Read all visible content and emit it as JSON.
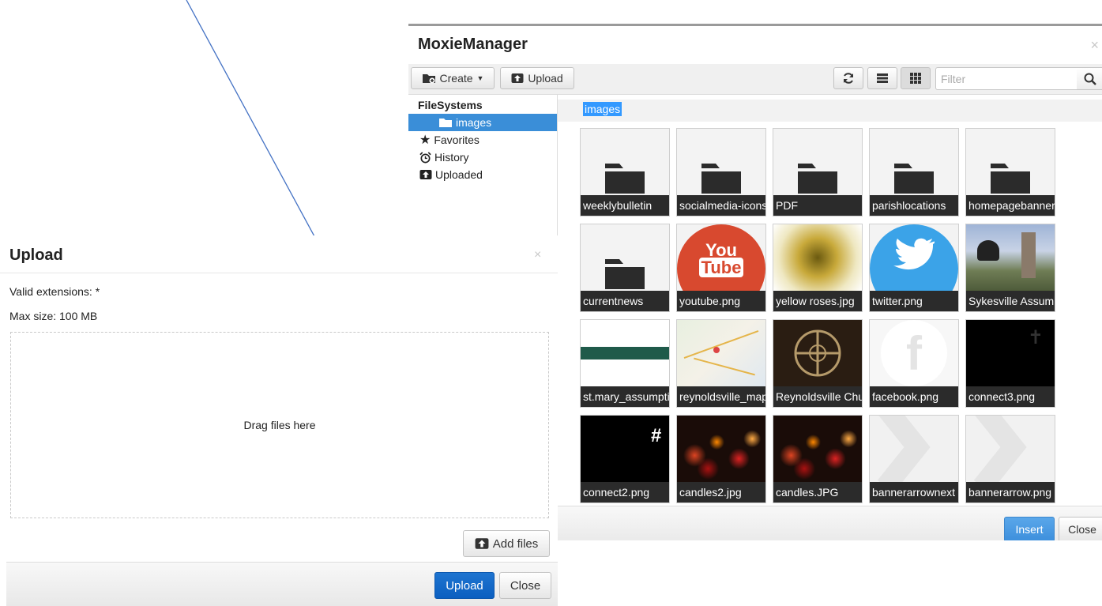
{
  "moxie": {
    "title": "MoxieManager",
    "close_glyph": "×",
    "toolbar": {
      "create_label": "Create",
      "upload_label": "Upload",
      "filter_placeholder": "Filter"
    },
    "sidebar": {
      "heading": "FileSystems",
      "items": [
        {
          "label": "images",
          "icon": "folder-icon",
          "active": true
        },
        {
          "label": "Favorites",
          "icon": "star-icon"
        },
        {
          "label": "History",
          "icon": "alarm-clock-icon"
        },
        {
          "label": "Uploaded",
          "icon": "upload-icon"
        }
      ]
    },
    "breadcrumb": "images",
    "files": [
      {
        "name": "weeklybulletin",
        "kind": "folder"
      },
      {
        "name": "socialmedia-icons",
        "kind": "folder"
      },
      {
        "name": "PDF",
        "kind": "folder"
      },
      {
        "name": "parishlocations",
        "kind": "folder"
      },
      {
        "name": "homepagebanners",
        "kind": "folder"
      },
      {
        "name": "currentnews",
        "kind": "folder"
      },
      {
        "name": "youtube.png",
        "kind": "youtube"
      },
      {
        "name": "yellow roses.jpg",
        "kind": "roses"
      },
      {
        "name": "twitter.png",
        "kind": "twitter"
      },
      {
        "name": "Sykesville Assumption",
        "kind": "church"
      },
      {
        "name": "st.mary_assumption",
        "kind": "banner"
      },
      {
        "name": "reynoldsville_map",
        "kind": "map"
      },
      {
        "name": "Reynoldsville Church",
        "kind": "window"
      },
      {
        "name": "facebook.png",
        "kind": "facebook"
      },
      {
        "name": "connect3.png",
        "kind": "connect3"
      },
      {
        "name": "connect2.png",
        "kind": "connect2"
      },
      {
        "name": "candles2.jpg",
        "kind": "candles"
      },
      {
        "name": "candles.JPG",
        "kind": "candles"
      },
      {
        "name": "bannerarrownext",
        "kind": "arrow"
      },
      {
        "name": "bannerarrow.png",
        "kind": "arrow"
      }
    ],
    "footer": {
      "insert_label": "Insert",
      "close_label": "Close"
    }
  },
  "upload": {
    "title": "Upload",
    "close_glyph": "×",
    "valid_extensions": "Valid extensions: *",
    "max_size": "Max size: 100 MB",
    "dropzone_text": "Drag files here",
    "add_files_label": "Add files",
    "upload_label": "Upload",
    "close_label": "Close"
  },
  "colors": {
    "accent": "#3a8ed8",
    "primary_upload": "#0b5fc0",
    "arrow": "#4472c4",
    "tile_label_bg": "#2b2b2b"
  }
}
